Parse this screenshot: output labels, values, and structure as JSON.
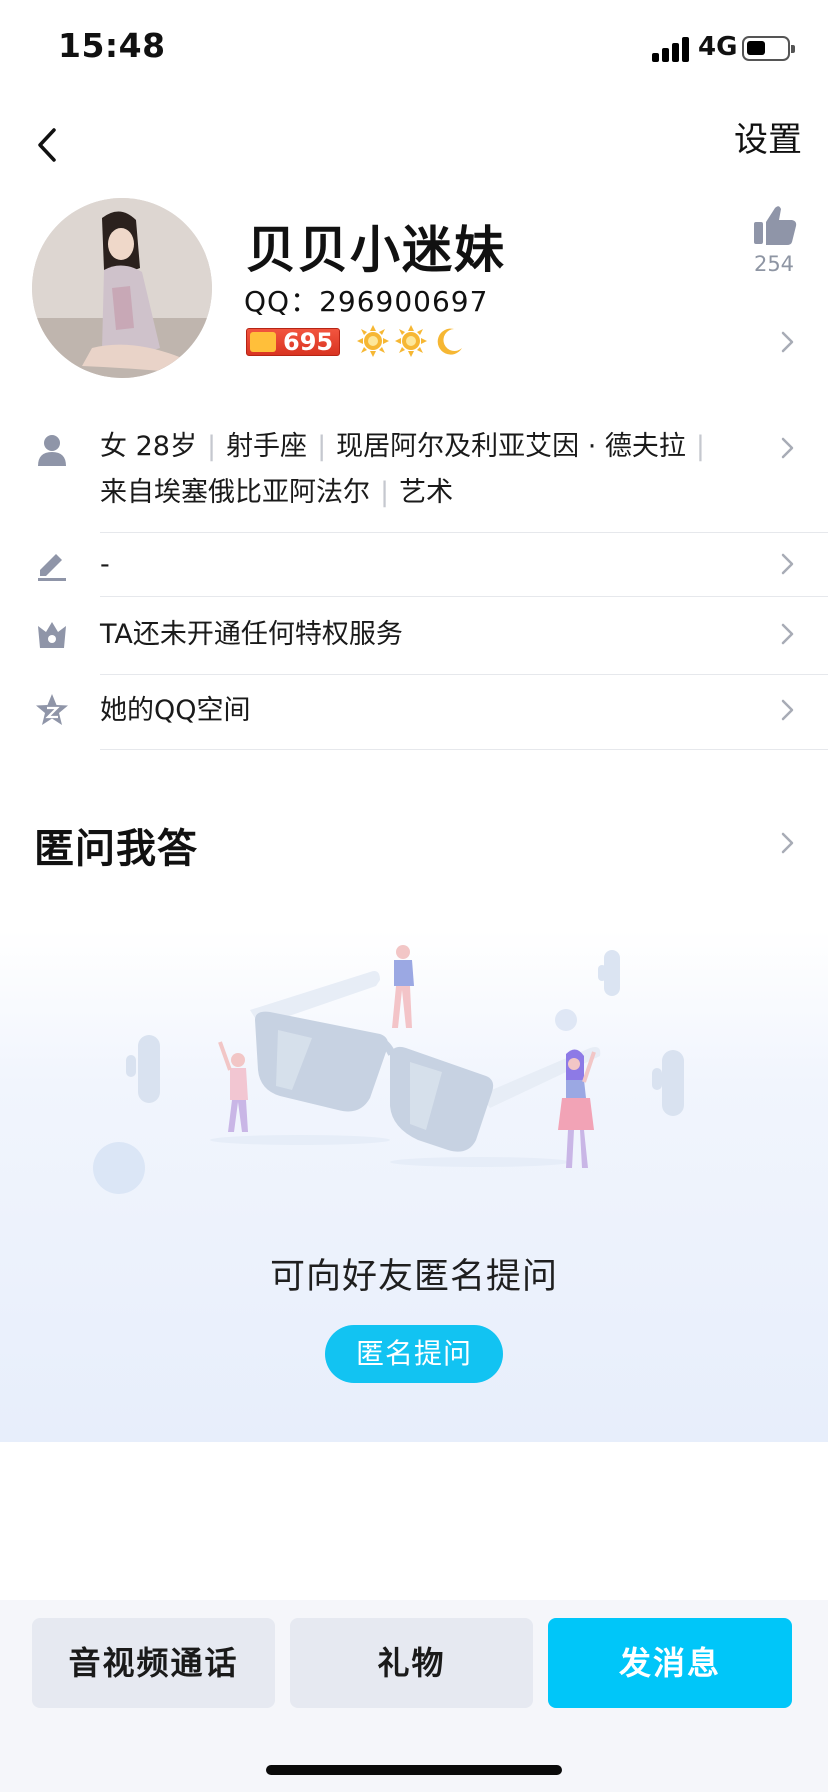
{
  "status_bar": {
    "time": "15:48",
    "network": "4G"
  },
  "nav": {
    "settings_label": "设置"
  },
  "profile": {
    "nickname": "贝贝小迷妹",
    "qq_label": "QQ：296900697",
    "level_number": "695",
    "likes": "254"
  },
  "info": {
    "basic": {
      "gender": "女",
      "age": "28岁",
      "zodiac": "射手座",
      "residence": "现居阿尔及利亚艾因 · 德夫拉",
      "hometown": "来自埃塞俄比亚阿法尔",
      "profession": "艺术"
    },
    "signature": "-",
    "privileges": "TA还未开通任何特权服务",
    "qzone": "她的QQ空间"
  },
  "anonymous_qa": {
    "title": "匿问我答",
    "caption": "可向好友匿名提问",
    "button_label": "匿名提问"
  },
  "actions": {
    "call_label": "音视频通话",
    "gift_label": "礼物",
    "message_label": "发消息"
  },
  "colors": {
    "accent": "#00c6f9",
    "ask_button": "#12c3f2",
    "icon_gray": "#8f95a8"
  }
}
